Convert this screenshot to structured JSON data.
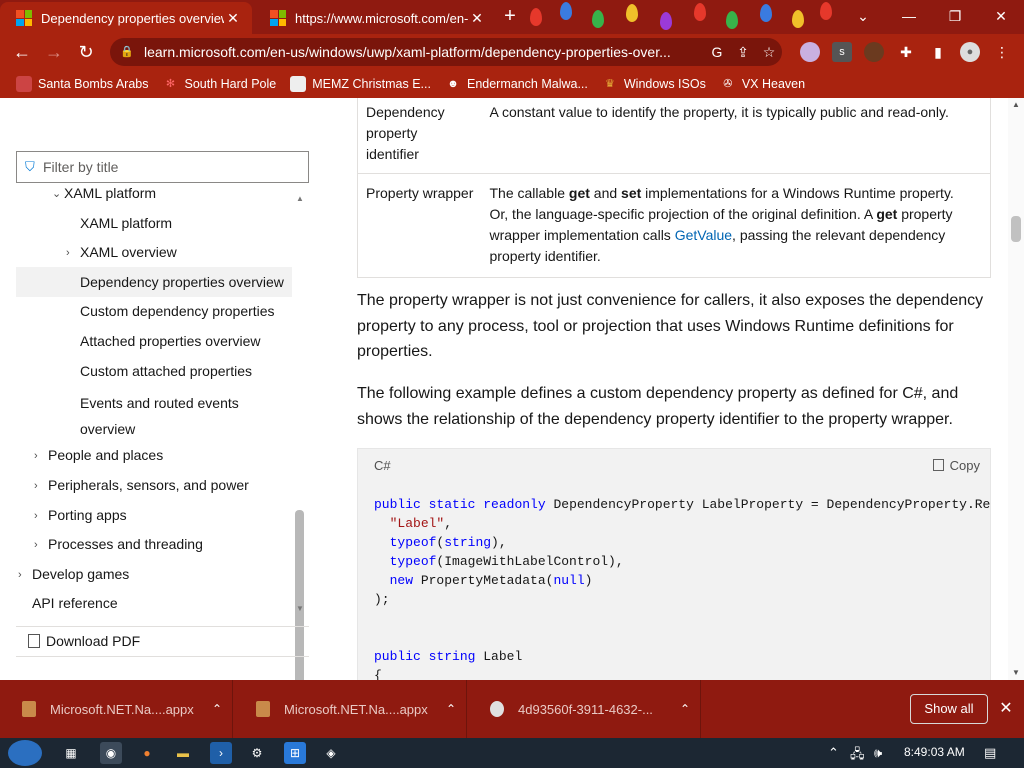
{
  "browser": {
    "tabs": [
      {
        "title": "Dependency properties overview",
        "active": true
      },
      {
        "title": "https://www.microsoft.com/en-us",
        "active": false
      }
    ],
    "url": "learn.microsoft.com/en-us/windows/uwp/xaml-platform/dependency-properties-over...",
    "bookmarks": [
      "Santa Bombs Arabs",
      "South Hard Pole",
      "MEMZ Christmas E...",
      "Endermanch Malwa...",
      "Windows ISOs",
      "VX Heaven"
    ],
    "colors": {
      "chrome": "#a9230f",
      "tabstrip": "#8f1a10"
    }
  },
  "sidebar": {
    "filter_placeholder": "Filter by title",
    "toc": [
      {
        "label": "XAML platform",
        "chevron": "down"
      },
      {
        "label": "XAML platform",
        "chevron": ""
      },
      {
        "label": "XAML overview",
        "chevron": "right"
      },
      {
        "label": "Dependency properties overview",
        "chevron": "",
        "selected": true
      },
      {
        "label": "Custom dependency properties",
        "chevron": ""
      },
      {
        "label": "Attached properties overview",
        "chevron": ""
      },
      {
        "label": "Custom attached properties",
        "chevron": ""
      },
      {
        "label": "Events and routed events overview",
        "chevron": ""
      },
      {
        "label": "People and places",
        "chevron": "right"
      },
      {
        "label": "Peripherals, sensors, and power",
        "chevron": "right"
      },
      {
        "label": "Porting apps",
        "chevron": "right"
      },
      {
        "label": "Processes and threading",
        "chevron": "right"
      },
      {
        "label": "Develop games",
        "chevron": "right"
      },
      {
        "label": "API reference",
        "chevron": ""
      }
    ],
    "download_pdf": "Download PDF"
  },
  "content": {
    "table": [
      {
        "term": "Dependency property identifier",
        "desc": "A constant value to identify the property, it is typically public and read-only."
      },
      {
        "term": "Property wrapper",
        "desc_parts": [
          "The callable ",
          "get",
          " and ",
          "set",
          " implementations for a Windows Runtime property. Or, the language-specific projection of the original definition. A ",
          "get",
          " property wrapper implementation calls ",
          "GetValue",
          ", passing the relevant dependency property identifier."
        ]
      }
    ],
    "para1": "The property wrapper is not just convenience for callers, it also exposes the dependency property to any process, tool or projection that uses Windows Runtime definitions for properties.",
    "para2": "The following example defines a custom dependency property as defined for C#, and shows the relationship of the dependency property identifier to the property wrapper.",
    "code": {
      "language": "C#",
      "copy_label": "Copy",
      "lines": [
        "public static readonly DependencyProperty LabelProperty = DependencyProperty.Reg",
        "  \"Label\",",
        "  typeof(string),",
        "  typeof(ImageWithLabelControl),",
        "  new PropertyMetadata(null)",
        ");",
        "",
        "",
        "public string Label",
        "{"
      ]
    }
  },
  "downloads": {
    "items": [
      "Microsoft.NET.Na....appx",
      "Microsoft.NET.Na....appx",
      "4d93560f-3911-4632-..."
    ],
    "show_all": "Show all"
  },
  "taskbar": {
    "clock": "8:49:03 AM"
  }
}
